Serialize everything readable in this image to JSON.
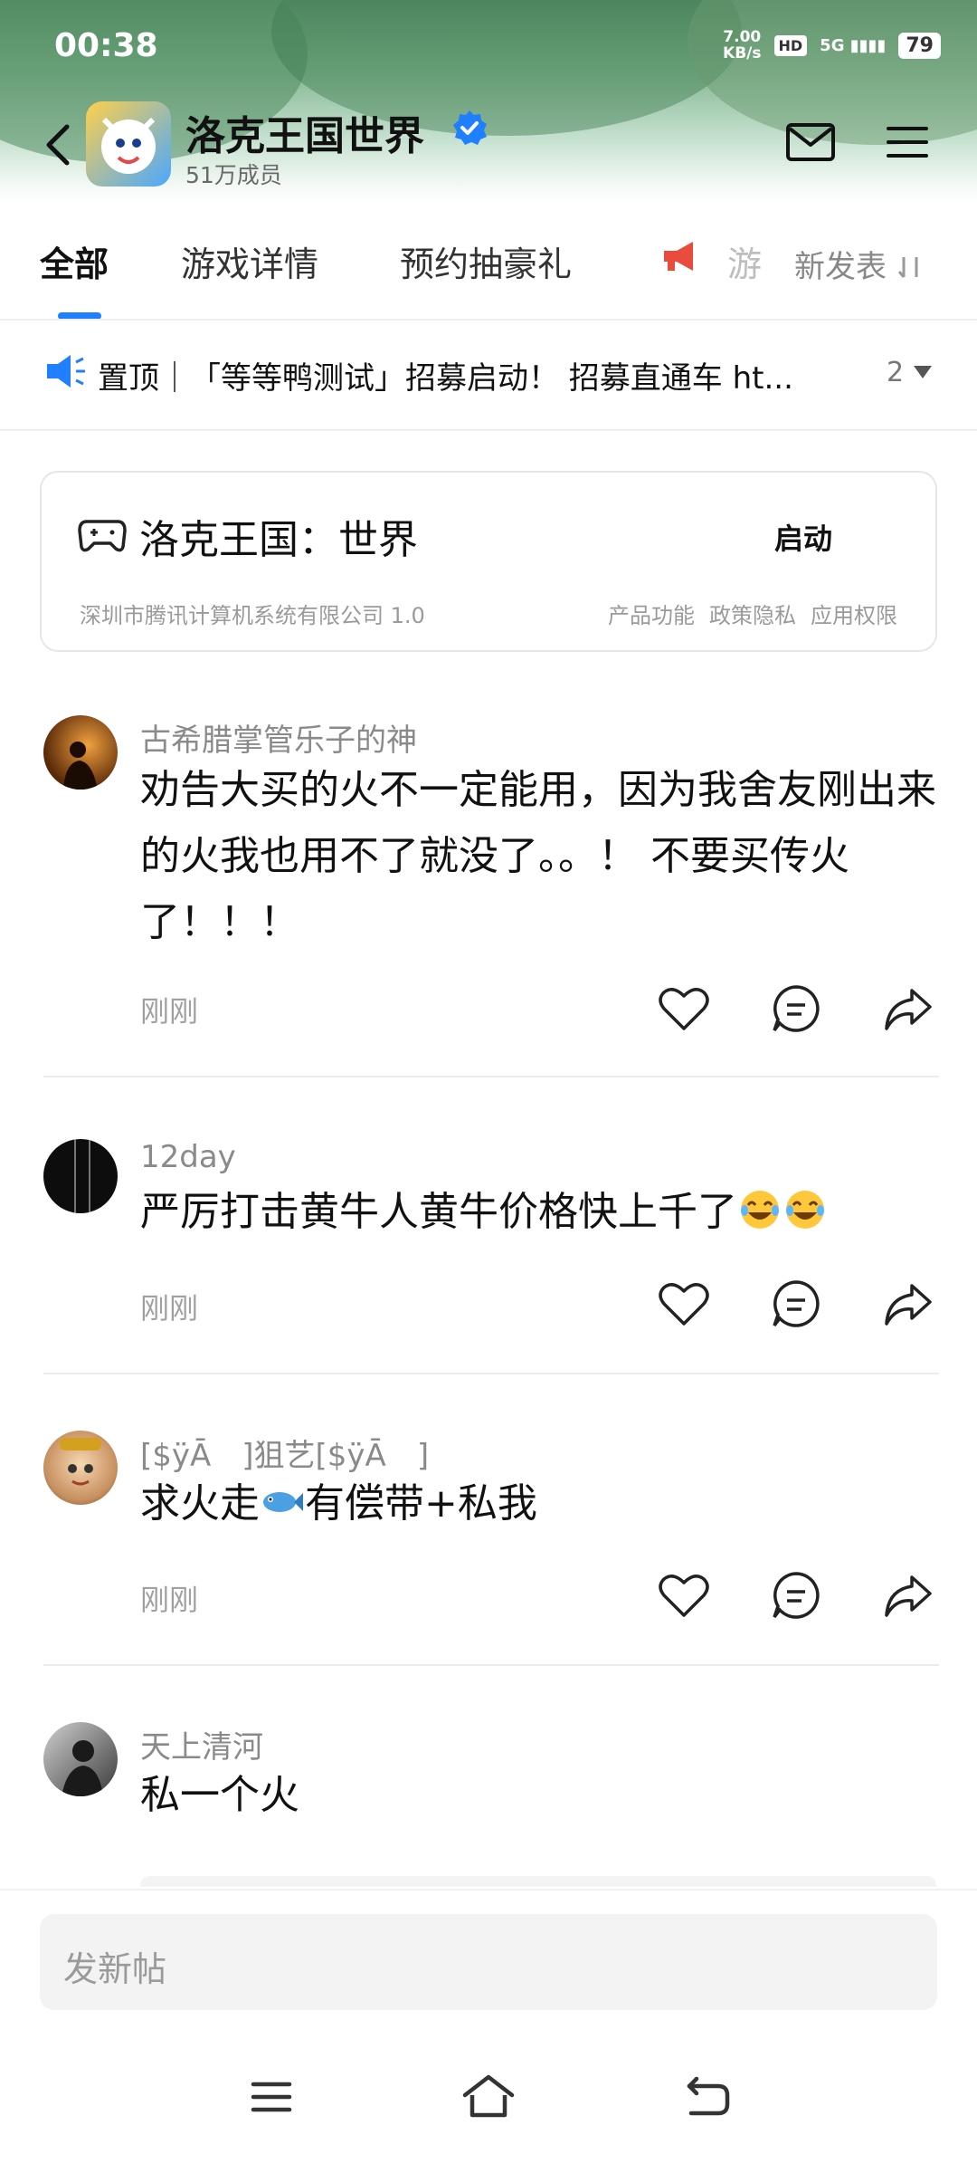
{
  "status_bar": {
    "time": "00:38",
    "net_speed_value": "7.00",
    "net_speed_unit": "KB/s",
    "hd_label": "HD",
    "network": "5G",
    "battery": "79"
  },
  "header": {
    "community_name": "洛克王国世界",
    "members": "51万成员",
    "icons": [
      "back-icon",
      "verified-icon",
      "mail-icon",
      "menu-icon"
    ]
  },
  "tabs": {
    "items": [
      "全部",
      "游戏详情",
      "预约抽豪礼",
      "游"
    ],
    "active": "全部",
    "sort_label": "新发表",
    "sort_icon": "sort-icon"
  },
  "pinned": {
    "text": "置顶｜「等等鸭测试」招募启动！ 招募直通车 ht...",
    "count": "2"
  },
  "game_card": {
    "name": "洛克王国：世界",
    "launch_label": "启动",
    "company_version": "深圳市腾讯计算机系统有限公司 1.0",
    "links": [
      "产品功能",
      "政策隐私",
      "应用权限"
    ]
  },
  "posts": [
    {
      "username": "古希腊掌管乐子的神",
      "content": "劝告大买的火不一定能用，因为我舍友刚出来的火我也用不了就没了。。！ 不要买传火了！！！",
      "time": "刚刚"
    },
    {
      "username": "12day",
      "content": "严厉打击黄牛人黄牛价格快上千了",
      "emojis": [
        "laughing-crying-emoji",
        "laughing-crying-emoji"
      ],
      "time": "刚刚"
    },
    {
      "username": "[$ÿĀ　]狙艺[$ÿĀ　]",
      "content_before": "求火走",
      "content_emoji": "fish-emoji",
      "content_after": "有偿带+私我",
      "time": "刚刚"
    },
    {
      "username": "天上清河",
      "content": "私一个火"
    }
  ],
  "compose": {
    "placeholder": "发新帖"
  },
  "accent_color": "#1f7fff"
}
